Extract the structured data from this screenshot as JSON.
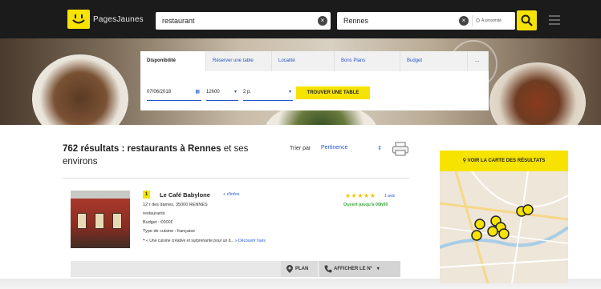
{
  "header": {
    "logo_text": "PagesJaunes",
    "search_what_value": "restaurant",
    "search_where_value": "Rennes",
    "proximity_label": "À proximité"
  },
  "booking": {
    "tabs": [
      {
        "label": "Disponibilité",
        "active": true
      },
      {
        "label": "Réserver une table",
        "active": false
      },
      {
        "label": "Localité",
        "active": false
      },
      {
        "label": "Bons Plans",
        "active": false
      },
      {
        "label": "Budget",
        "active": false
      },
      {
        "label": "...",
        "active": false
      }
    ],
    "date_value": "07/06/2018",
    "time_value": "12h00",
    "people_value": "2 p.",
    "find_button": "TROUVER UNE TABLE"
  },
  "results": {
    "count_text": "762 résultats : restaurants à Rennes",
    "suffix_text": " et ses environs",
    "sort_label": "Trier par",
    "sort_value": "Pertinence"
  },
  "listing": {
    "number": "1",
    "name": "Le Café Babylone",
    "info_link": "+ d'infos",
    "address": "12 r des dames, 35000 RENNES",
    "category": "restaurants",
    "budget": "Budget : €€€€€",
    "cuisine": "Type de cuisine : française",
    "quote": "« Une cuisine créative et surprenante pour un d... »",
    "quote_more": "Découvrir l'avis",
    "rating": 5,
    "review_link": "1 avis",
    "open_status": "Ouvert jusqu'à 00h00",
    "plan_button": "PLAN",
    "phone_button": "AFFICHER LE N°"
  },
  "map": {
    "button_label": "VOIR LA CARTE DES RÉSULTATS"
  },
  "colors": {
    "brand_yellow": "#f6e400",
    "link_blue": "#2255cc",
    "header_dark": "#1b1b1b",
    "open_green": "#3aa63a"
  }
}
